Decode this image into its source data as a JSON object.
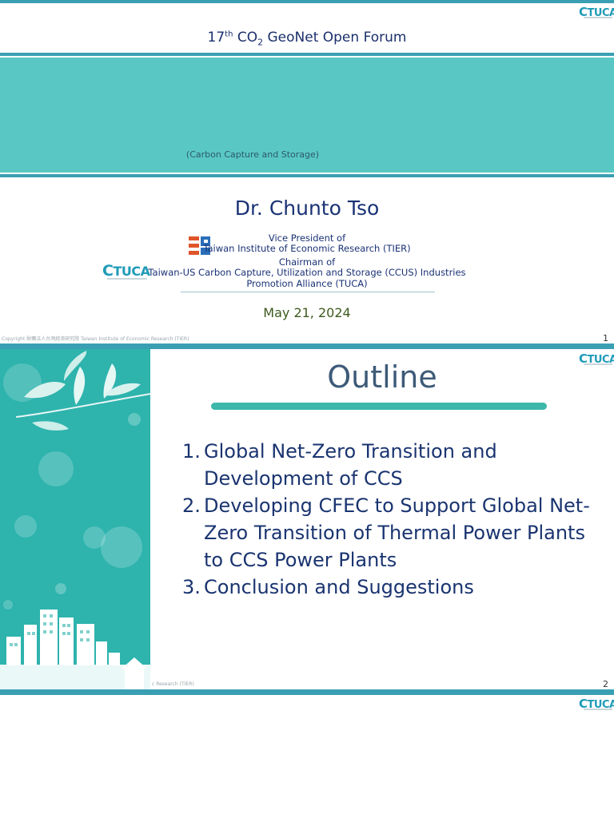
{
  "slide1": {
    "title_prefix": "17",
    "title_sup": "th",
    "title_co": " CO",
    "title_sub": "2",
    "title_rest": " GeoNet Open Forum",
    "subtitle": "(Carbon Capture and Storage)",
    "presenter": "Dr. Chunto Tso",
    "role1_title": "Vice President of",
    "role1_org": "Taiwan Institute of Economic Research (TIER)",
    "role2_title": "Chairman of",
    "role2_org_line1": "Taiwan-US Carbon Capture, Utilization and Storage (CCUS) Industries",
    "role2_org_line2": "Promotion Alliance (TUCA)",
    "date": "May 21, 2024",
    "copyright": "Copyright 財團法人台灣經濟研究院 Taiwan Institute of Economic Research (TIER)",
    "page_number": "1",
    "logo_tuca": "TUCA"
  },
  "slide2": {
    "title": "Outline",
    "items": [
      {
        "num": "1.",
        "text": "Global Net-Zero Transition and Development of CCS"
      },
      {
        "num": "2.",
        "text": "Developing CFEC to Support Global Net-Zero Transition of Thermal Power Plants to CCS Power Plants"
      },
      {
        "num": "3.",
        "text": "Conclusion and Suggestions"
      }
    ],
    "copyright_fragment": "c Research (TIER)",
    "page_number": "2",
    "logo_tuca": "TUCA"
  },
  "slide3": {
    "logo_tuca": "TUCA"
  },
  "colors": {
    "teal_bar": "#3a9fb3",
    "banner": "#59c8c4",
    "sidebar": "#2eb3ad",
    "rule": "#3cb7aa",
    "title_navy": "#1a3275"
  }
}
